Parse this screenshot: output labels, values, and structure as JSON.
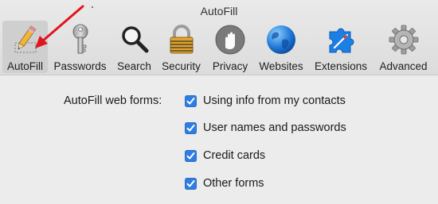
{
  "window": {
    "title": "AutoFill"
  },
  "toolbar": {
    "tabs": [
      {
        "id": "autofill",
        "label": "AutoFill",
        "icon": "pencil-form-icon",
        "selected": true
      },
      {
        "id": "passwords",
        "label": "Passwords",
        "icon": "key-icon",
        "selected": false
      },
      {
        "id": "search",
        "label": "Search",
        "icon": "magnifier-icon",
        "selected": false
      },
      {
        "id": "security",
        "label": "Security",
        "icon": "padlock-icon",
        "selected": false
      },
      {
        "id": "privacy",
        "label": "Privacy",
        "icon": "hand-icon",
        "selected": false
      },
      {
        "id": "websites",
        "label": "Websites",
        "icon": "globe-icon",
        "selected": false
      },
      {
        "id": "extensions",
        "label": "Extensions",
        "icon": "puzzle-piece-icon",
        "selected": false
      },
      {
        "id": "advanced",
        "label": "Advanced",
        "icon": "gear-icon",
        "selected": false
      }
    ]
  },
  "autofill": {
    "label": "AutoFill web forms:",
    "options": [
      {
        "label": "Using info from my contacts",
        "checked": true
      },
      {
        "label": "User names and passwords",
        "checked": true
      },
      {
        "label": "Credit cards",
        "checked": true
      },
      {
        "label": "Other forms",
        "checked": true
      }
    ]
  },
  "colors": {
    "checkbox": "#2f7de1",
    "annotation_arrow": "#e0151d",
    "toolbar_bg": "#e3e3e3",
    "selected_tab_bg": "#cfcfcf"
  }
}
